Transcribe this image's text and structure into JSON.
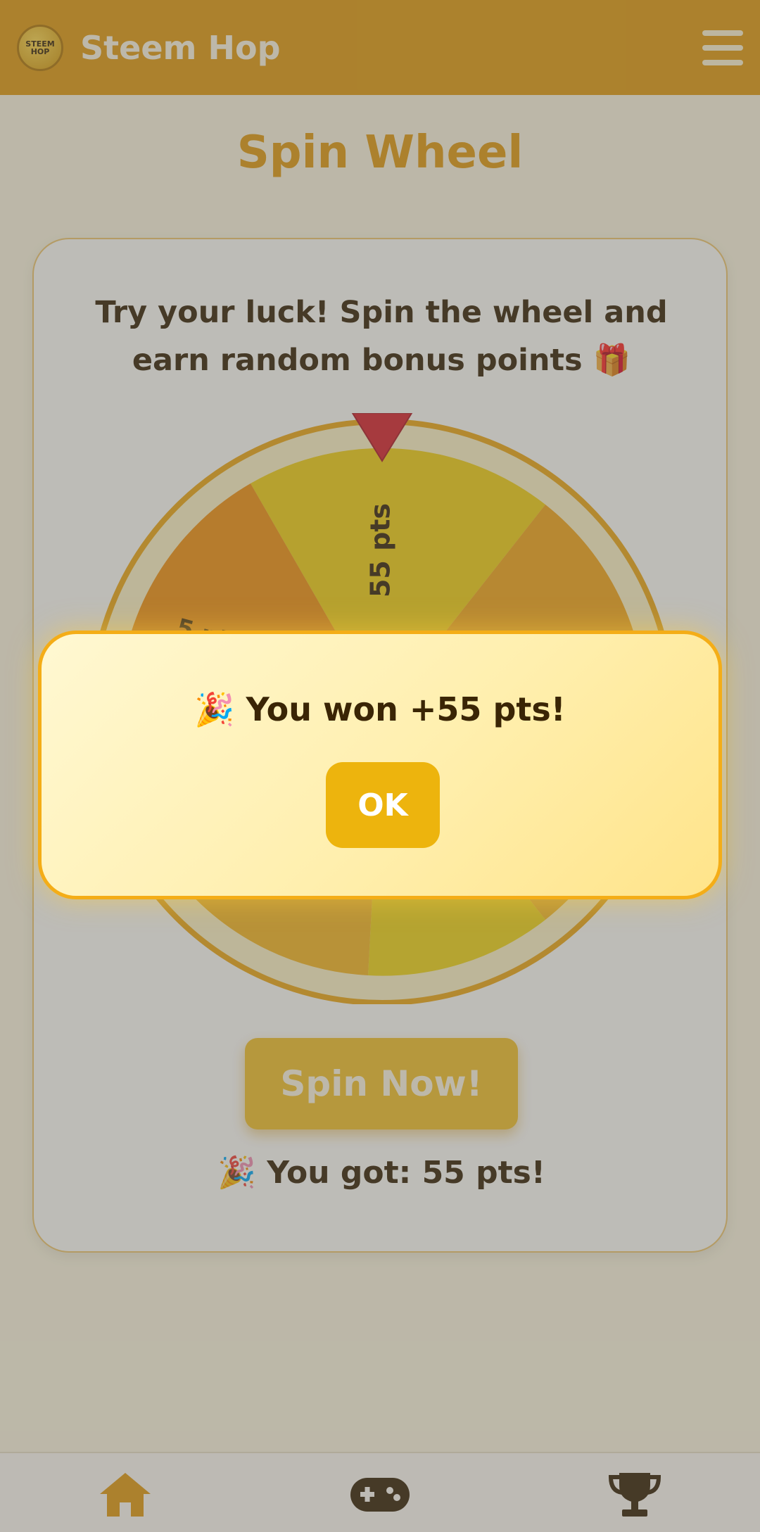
{
  "header": {
    "logo_text": "STEEM HOP",
    "app_title": "Steem Hop"
  },
  "page": {
    "title": "Spin Wheel"
  },
  "card": {
    "description": "Try your luck! Spin the wheel and earn random bonus points 🎁",
    "spin_button_label": "Spin Now!",
    "result_text": "🎉 You got: 55 pts!"
  },
  "wheel": {
    "visible_segment_labels": [
      "55 pts",
      "5 pt"
    ]
  },
  "modal": {
    "message": "🎉 You won +55 pts!",
    "ok_label": "OK"
  },
  "bottom_nav": {
    "items": [
      "home-icon",
      "gamepad-icon",
      "trophy-icon"
    ]
  },
  "colors": {
    "primary": "#e39c0f",
    "dark_text": "#3a2505",
    "wheel_gold": "#f4c12b",
    "pointer_red": "#d9262c"
  }
}
